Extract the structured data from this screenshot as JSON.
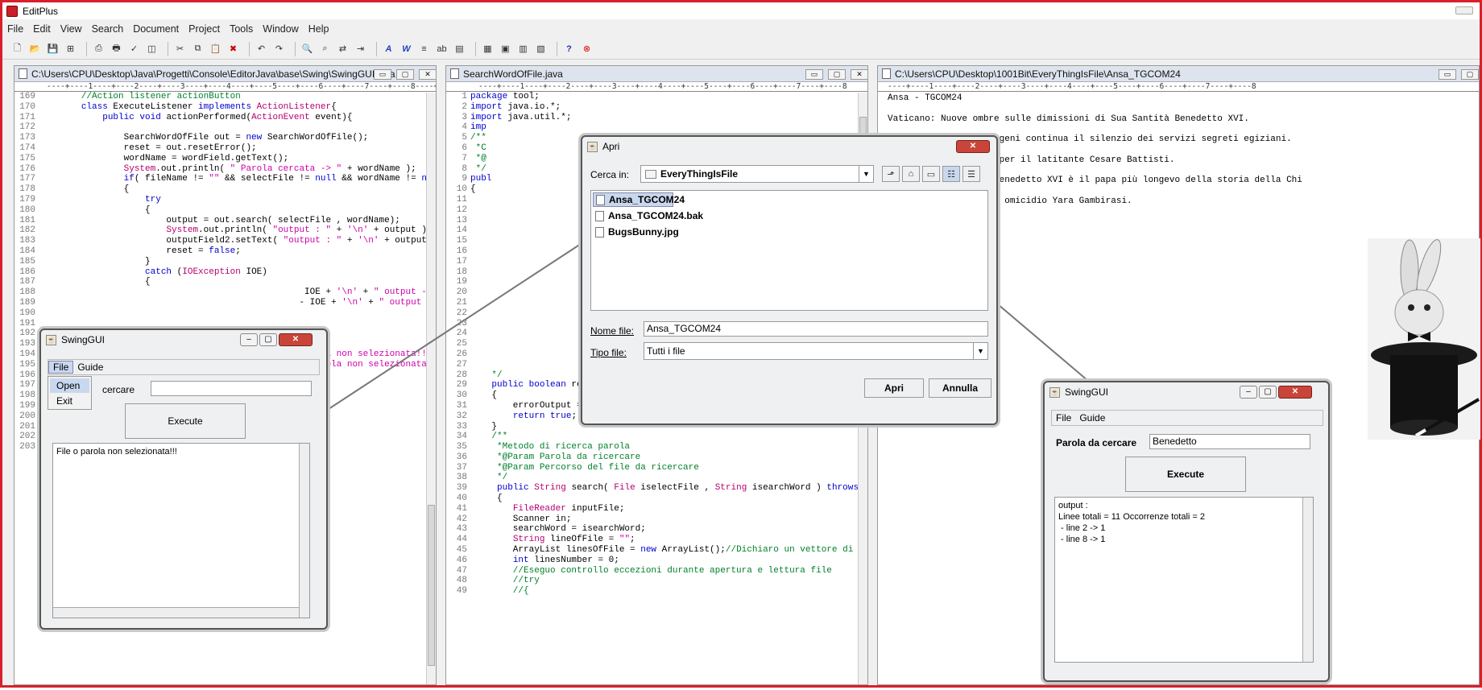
{
  "app": {
    "title": "EditPlus"
  },
  "menubar": [
    "File",
    "Edit",
    "View",
    "Search",
    "Document",
    "Project",
    "Tools",
    "Window",
    "Help"
  ],
  "toolbar_icons": [
    "new-file-icon",
    "open-file-icon",
    "save-icon",
    "save-all-icon",
    "sep",
    "print-preview-icon",
    "print-icon",
    "spell-check-icon",
    "browser-icon",
    "sep",
    "cut-icon",
    "copy-icon",
    "paste-icon",
    "delete-icon",
    "sep",
    "undo-icon",
    "redo-icon",
    "sep",
    "find-icon",
    "find-next-icon",
    "replace-icon",
    "goto-icon",
    "sep",
    "font-icon",
    "word-wrap-icon",
    "ruler-icon",
    "abc-icon",
    "column-icon",
    "sep",
    "user-tool-icon",
    "browser-preview-icon",
    "cliptext-icon",
    "directory-icon",
    "sep",
    "help-icon",
    "stop-icon"
  ],
  "editor1": {
    "path": "C:\\Users\\CPU\\Desktop\\Java\\Progetti\\Console\\EditorJava\\base\\Swing\\SwingGUI.java",
    "ruler": "----+----1----+----2----+----3----+----4----+----5----+----6----+----7----+----8----+----9",
    "lines": [
      {
        "n": "169",
        "t": [
          [
            "cm",
            "        //Action listener actionButton"
          ]
        ]
      },
      {
        "n": "170",
        "t": [
          [
            "",
            "        "
          ],
          [
            "kw",
            "class"
          ],
          [
            "",
            " ExecuteListener "
          ],
          [
            "kw",
            "implements"
          ],
          [
            "",
            " "
          ],
          [
            "ty",
            "ActionListener"
          ],
          [
            "",
            "{"
          ]
        ]
      },
      {
        "n": "171",
        "t": [
          [
            "",
            "            "
          ],
          [
            "kw",
            "public void"
          ],
          [
            "",
            " actionPerformed("
          ],
          [
            "ty",
            "ActionEvent"
          ],
          [
            "",
            " event){"
          ]
        ]
      },
      {
        "n": "172",
        "t": [
          [
            "",
            ""
          ]
        ]
      },
      {
        "n": "173",
        "t": [
          [
            "",
            "                SearchWordOfFile out = "
          ],
          [
            "kw",
            "new"
          ],
          [
            "",
            " SearchWordOfFile();"
          ]
        ]
      },
      {
        "n": "174",
        "t": [
          [
            "",
            "                reset = out.resetError();"
          ]
        ]
      },
      {
        "n": "175",
        "t": [
          [
            "",
            "                wordName = wordField.getText();"
          ]
        ]
      },
      {
        "n": "176",
        "t": [
          [
            "",
            "                "
          ],
          [
            "ty",
            "System"
          ],
          [
            "",
            ".out.println( "
          ],
          [
            "st",
            "\" Parola cercata -> \""
          ],
          [
            "",
            " + wordName );"
          ]
        ]
      },
      {
        "n": "177",
        "t": [
          [
            "",
            "                "
          ],
          [
            "kw",
            "if"
          ],
          [
            "",
            "( fileName != "
          ],
          [
            "st",
            "\"\""
          ],
          [
            "",
            " && selectFile != "
          ],
          [
            "kw",
            "null"
          ],
          [
            "",
            " && wordName != "
          ],
          [
            "kw",
            "null"
          ],
          [
            "",
            ")"
          ]
        ]
      },
      {
        "n": "178",
        "t": [
          [
            "",
            "                {"
          ]
        ]
      },
      {
        "n": "179",
        "t": [
          [
            "",
            "                    "
          ],
          [
            "kw",
            "try"
          ]
        ]
      },
      {
        "n": "180",
        "t": [
          [
            "",
            "                    {"
          ]
        ]
      },
      {
        "n": "181",
        "t": [
          [
            "",
            "                        output = out.search( selectFile , wordName);"
          ]
        ]
      },
      {
        "n": "182",
        "t": [
          [
            "",
            "                        "
          ],
          [
            "ty",
            "System"
          ],
          [
            "",
            ".out.println( "
          ],
          [
            "st",
            "\"output : \""
          ],
          [
            "",
            " + "
          ],
          [
            "st",
            "'\\n'"
          ],
          [
            "",
            " + output );"
          ]
        ]
      },
      {
        "n": "183",
        "t": [
          [
            "",
            "                        outputField2.setText( "
          ],
          [
            "st",
            "\"output : \""
          ],
          [
            "",
            " + "
          ],
          [
            "st",
            "'\\n'"
          ],
          [
            "",
            " + output );"
          ]
        ]
      },
      {
        "n": "184",
        "t": [
          [
            "",
            "                        reset = "
          ],
          [
            "kw",
            "false"
          ],
          [
            "",
            ";"
          ]
        ]
      },
      {
        "n": "185",
        "t": [
          [
            "",
            "                    }"
          ]
        ]
      },
      {
        "n": "186",
        "t": [
          [
            "",
            "                    "
          ],
          [
            "kw",
            "catch"
          ],
          [
            "",
            " ("
          ],
          [
            "ty",
            "IOException"
          ],
          [
            "",
            " IOE)"
          ]
        ]
      },
      {
        "n": "187",
        "t": [
          [
            "",
            "                    {"
          ]
        ]
      },
      {
        "n": "188",
        "t": [
          [
            "",
            "                                                  IOE + "
          ],
          [
            "st",
            "'\\n'"
          ],
          [
            "",
            " + "
          ],
          [
            "st",
            "\" output -> \""
          ],
          [
            "",
            " + o"
          ]
        ]
      },
      {
        "n": "189",
        "t": [
          [
            "",
            "                                                 - IOE + "
          ],
          [
            "st",
            "'\\n'"
          ],
          [
            "",
            " + "
          ],
          [
            "st",
            "\" output -> \""
          ],
          [
            "",
            " +"
          ]
        ]
      },
      {
        "n": "190",
        "t": [
          [
            "",
            ""
          ]
        ]
      },
      {
        "n": "191",
        "t": [
          [
            "",
            ""
          ]
        ]
      },
      {
        "n": "192",
        "t": [
          [
            "",
            ""
          ]
        ]
      },
      {
        "n": "193",
        "t": [
          [
            "",
            ""
          ]
        ]
      },
      {
        "n": "194",
        "t": [
          [
            "",
            "                                                 "
          ],
          [
            "st",
            "parola non selezionata!!! \""
          ],
          [
            "",
            " )"
          ]
        ]
      },
      {
        "n": "195",
        "t": [
          [
            "",
            "                                                 "
          ],
          [
            "st",
            "o parola non selezionata!!! \""
          ]
        ]
      },
      {
        "n": "196",
        "t": [
          [
            "",
            ""
          ]
        ]
      },
      {
        "n": "197",
        "t": [
          [
            "",
            ""
          ]
        ]
      },
      {
        "n": "198",
        "t": [
          [
            "",
            ""
          ]
        ]
      },
      {
        "n": "199",
        "t": [
          [
            "",
            ""
          ]
        ]
      },
      {
        "n": "200",
        "t": [
          [
            "",
            "                                                 ner();"
          ]
        ]
      },
      {
        "n": "201",
        "t": [
          [
            "",
            ""
          ]
        ]
      },
      {
        "n": "202",
        "t": [
          [
            "",
            ""
          ]
        ]
      },
      {
        "n": "203",
        "t": [
          [
            "",
            ""
          ]
        ]
      }
    ]
  },
  "editor2": {
    "path": "SearchWordOfFile.java",
    "ruler": "----+----1----+----2----+----3----+----4----+----5----+----6----+----7----+----8",
    "lines": [
      {
        "n": "1",
        "t": [
          [
            "kw",
            "package"
          ],
          [
            "",
            " tool;"
          ]
        ]
      },
      {
        "n": "2",
        "t": [
          [
            "kw",
            "import"
          ],
          [
            "",
            " java.io.*;"
          ]
        ]
      },
      {
        "n": "3",
        "t": [
          [
            "kw",
            "import"
          ],
          [
            "",
            " java.util.*;"
          ]
        ]
      },
      {
        "n": "4",
        "t": [
          [
            "kw",
            "imp"
          ]
        ]
      },
      {
        "n": "5",
        "t": [
          [
            "cm",
            "/**"
          ]
        ]
      },
      {
        "n": "6",
        "t": [
          [
            "cm",
            " *C"
          ]
        ]
      },
      {
        "n": "7",
        "t": [
          [
            "cm",
            " *@"
          ]
        ]
      },
      {
        "n": "8",
        "t": [
          [
            "cm",
            " */"
          ]
        ]
      },
      {
        "n": "9",
        "t": [
          [
            "kw",
            "publ"
          ]
        ]
      },
      {
        "n": "10",
        "t": [
          [
            "",
            "{"
          ]
        ]
      },
      {
        "n": "11",
        "t": [
          [
            "",
            ""
          ]
        ]
      },
      {
        "n": "12",
        "t": [
          [
            "",
            ""
          ]
        ]
      },
      {
        "n": "13",
        "t": [
          [
            "",
            ""
          ]
        ]
      },
      {
        "n": "14",
        "t": [
          [
            "",
            ""
          ]
        ]
      },
      {
        "n": "15",
        "t": [
          [
            "",
            ""
          ]
        ]
      },
      {
        "n": "16",
        "t": [
          [
            "",
            ""
          ]
        ]
      },
      {
        "n": "17",
        "t": [
          [
            "",
            ""
          ]
        ]
      },
      {
        "n": "18",
        "t": [
          [
            "",
            ""
          ]
        ]
      },
      {
        "n": "19",
        "t": [
          [
            "",
            ""
          ]
        ]
      },
      {
        "n": "20",
        "t": [
          [
            "",
            ""
          ]
        ]
      },
      {
        "n": "21",
        "t": [
          [
            "",
            ""
          ]
        ]
      },
      {
        "n": "22",
        "t": [
          [
            "",
            ""
          ]
        ]
      },
      {
        "n": "23",
        "t": [
          [
            "",
            ""
          ]
        ]
      },
      {
        "n": "24",
        "t": [
          [
            "",
            ""
          ]
        ]
      },
      {
        "n": "25",
        "t": [
          [
            "",
            ""
          ]
        ]
      },
      {
        "n": "26",
        "t": [
          [
            "",
            ""
          ]
        ]
      },
      {
        "n": "27",
        "t": [
          [
            "",
            ""
          ]
        ]
      },
      {
        "n": "28",
        "t": [
          [
            "cm",
            "    */"
          ]
        ]
      },
      {
        "n": "29",
        "t": [
          [
            "",
            "    "
          ],
          [
            "kw",
            "public boolean"
          ],
          [
            "",
            " resetError()"
          ]
        ]
      },
      {
        "n": "30",
        "t": [
          [
            "",
            "    {"
          ]
        ]
      },
      {
        "n": "31",
        "t": [
          [
            "",
            "        errorOutput = "
          ],
          [
            "st",
            "\"\""
          ],
          [
            "",
            ";"
          ]
        ]
      },
      {
        "n": "32",
        "t": [
          [
            "",
            "        "
          ],
          [
            "kw",
            "return true"
          ],
          [
            "",
            ";"
          ]
        ]
      },
      {
        "n": "33",
        "t": [
          [
            "",
            "    }"
          ]
        ]
      },
      {
        "n": "34",
        "t": [
          [
            "cm",
            "    /**"
          ]
        ]
      },
      {
        "n": "35",
        "t": [
          [
            "cm",
            "     *Metodo di ricerca parola"
          ]
        ]
      },
      {
        "n": "36",
        "t": [
          [
            "cm",
            "     *@Param Parola da ricercare"
          ]
        ]
      },
      {
        "n": "37",
        "t": [
          [
            "cm",
            "     *@Param Percorso del file da ricercare"
          ]
        ]
      },
      {
        "n": "38",
        "t": [
          [
            "cm",
            "     */"
          ]
        ]
      },
      {
        "n": "39",
        "t": [
          [
            "",
            "     "
          ],
          [
            "kw",
            "public"
          ],
          [
            "",
            " "
          ],
          [
            "ty",
            "String"
          ],
          [
            "",
            " search( "
          ],
          [
            "ty",
            "File"
          ],
          [
            "",
            " iselectFile , "
          ],
          [
            "ty",
            "String"
          ],
          [
            "",
            " isearchWord ) "
          ],
          [
            "kw",
            "throws"
          ],
          [
            "",
            " "
          ],
          [
            "ty",
            "IOExc"
          ]
        ]
      },
      {
        "n": "40",
        "t": [
          [
            "",
            "     {"
          ]
        ]
      },
      {
        "n": "41",
        "t": [
          [
            "",
            "        "
          ],
          [
            "ty",
            "FileReader"
          ],
          [
            "",
            " inputFile;"
          ]
        ]
      },
      {
        "n": "42",
        "t": [
          [
            "",
            "        Scanner in;"
          ]
        ]
      },
      {
        "n": "43",
        "t": [
          [
            "",
            "        searchWord = isearchWord;"
          ]
        ]
      },
      {
        "n": "44",
        "t": [
          [
            "",
            "        "
          ],
          [
            "ty",
            "String"
          ],
          [
            "",
            " lineOfFile = "
          ],
          [
            "st",
            "\"\""
          ],
          [
            "",
            ";"
          ]
        ]
      },
      {
        "n": "45",
        "t": [
          [
            "",
            "        ArrayList linesOfFile = "
          ],
          [
            "kw",
            "new"
          ],
          [
            "",
            " ArrayList();"
          ],
          [
            "cm",
            "//Dichiaro un vettore di oggett"
          ]
        ]
      },
      {
        "n": "46",
        "t": [
          [
            "",
            "        "
          ],
          [
            "kw",
            "int"
          ],
          [
            "",
            " linesNumber = 0;"
          ]
        ]
      },
      {
        "n": "47",
        "t": [
          [
            "cm",
            "        //Eseguo controllo eccezioni durante apertura e lettura file"
          ]
        ]
      },
      {
        "n": "48",
        "t": [
          [
            "cm",
            "        //try"
          ]
        ]
      },
      {
        "n": "49",
        "t": [
          [
            "cm",
            "        //{"
          ]
        ]
      }
    ]
  },
  "editor3": {
    "path": "C:\\Users\\CPU\\Desktop\\1001Bit\\EveryThingIsFile\\Ansa_TGCOM24",
    "ruler": "----+----1----+----2----+----3----+----4----+----5----+----6----+----7----+----8",
    "lines": [
      "Ansa - TGCOM24",
      "",
      "Vaticano: Nuove ombre sulle dimissioni di Sua Santità Benedetto XVI.",
      "",
      "Estero: Su Giulio Reggeni continua il silenzio dei servizi segreti egiziani.",
      "",
      "Giustizia: Ergastolo per il latitante Cesare Battisti.",
      "",
      "Storia: Sua Santità Benedetto XVI è il papa più longevo della storia della Chi",
      "",
      "Cronaca: E' svolta su omicidio Yara Gambirasi."
    ]
  },
  "swing1": {
    "title": "SwingGUI",
    "menu": [
      "File",
      "Guide"
    ],
    "dropdown": [
      "Open",
      "Exit"
    ],
    "search_label": "cercare",
    "search_value": "",
    "execute": "Execute",
    "output": "File o parola non selezionata!!!"
  },
  "open_dialog": {
    "title": "Apri",
    "look_in_label": "Cerca in:",
    "look_in_value": "EveryThingIsFile",
    "files": [
      "Ansa_TGCOM24",
      "Ansa_TGCOM24.bak",
      "BugsBunny.jpg"
    ],
    "filename_label": "Nome file:",
    "filename_value": "Ansa_TGCOM24",
    "filetype_label": "Tipo file:",
    "filetype_value": "Tutti i file",
    "open_button": "Apri",
    "cancel_button": "Annulla"
  },
  "swing2": {
    "title": "SwingGUI",
    "menu": [
      "File",
      "Guide"
    ],
    "search_label": "Parola da cercare",
    "search_value": "Benedetto",
    "execute": "Execute",
    "output": [
      "output :",
      "Linee totali = 11 Occorrenze totali = 2",
      " - line 2 -> 1",
      " - line 8 -> 1"
    ]
  }
}
